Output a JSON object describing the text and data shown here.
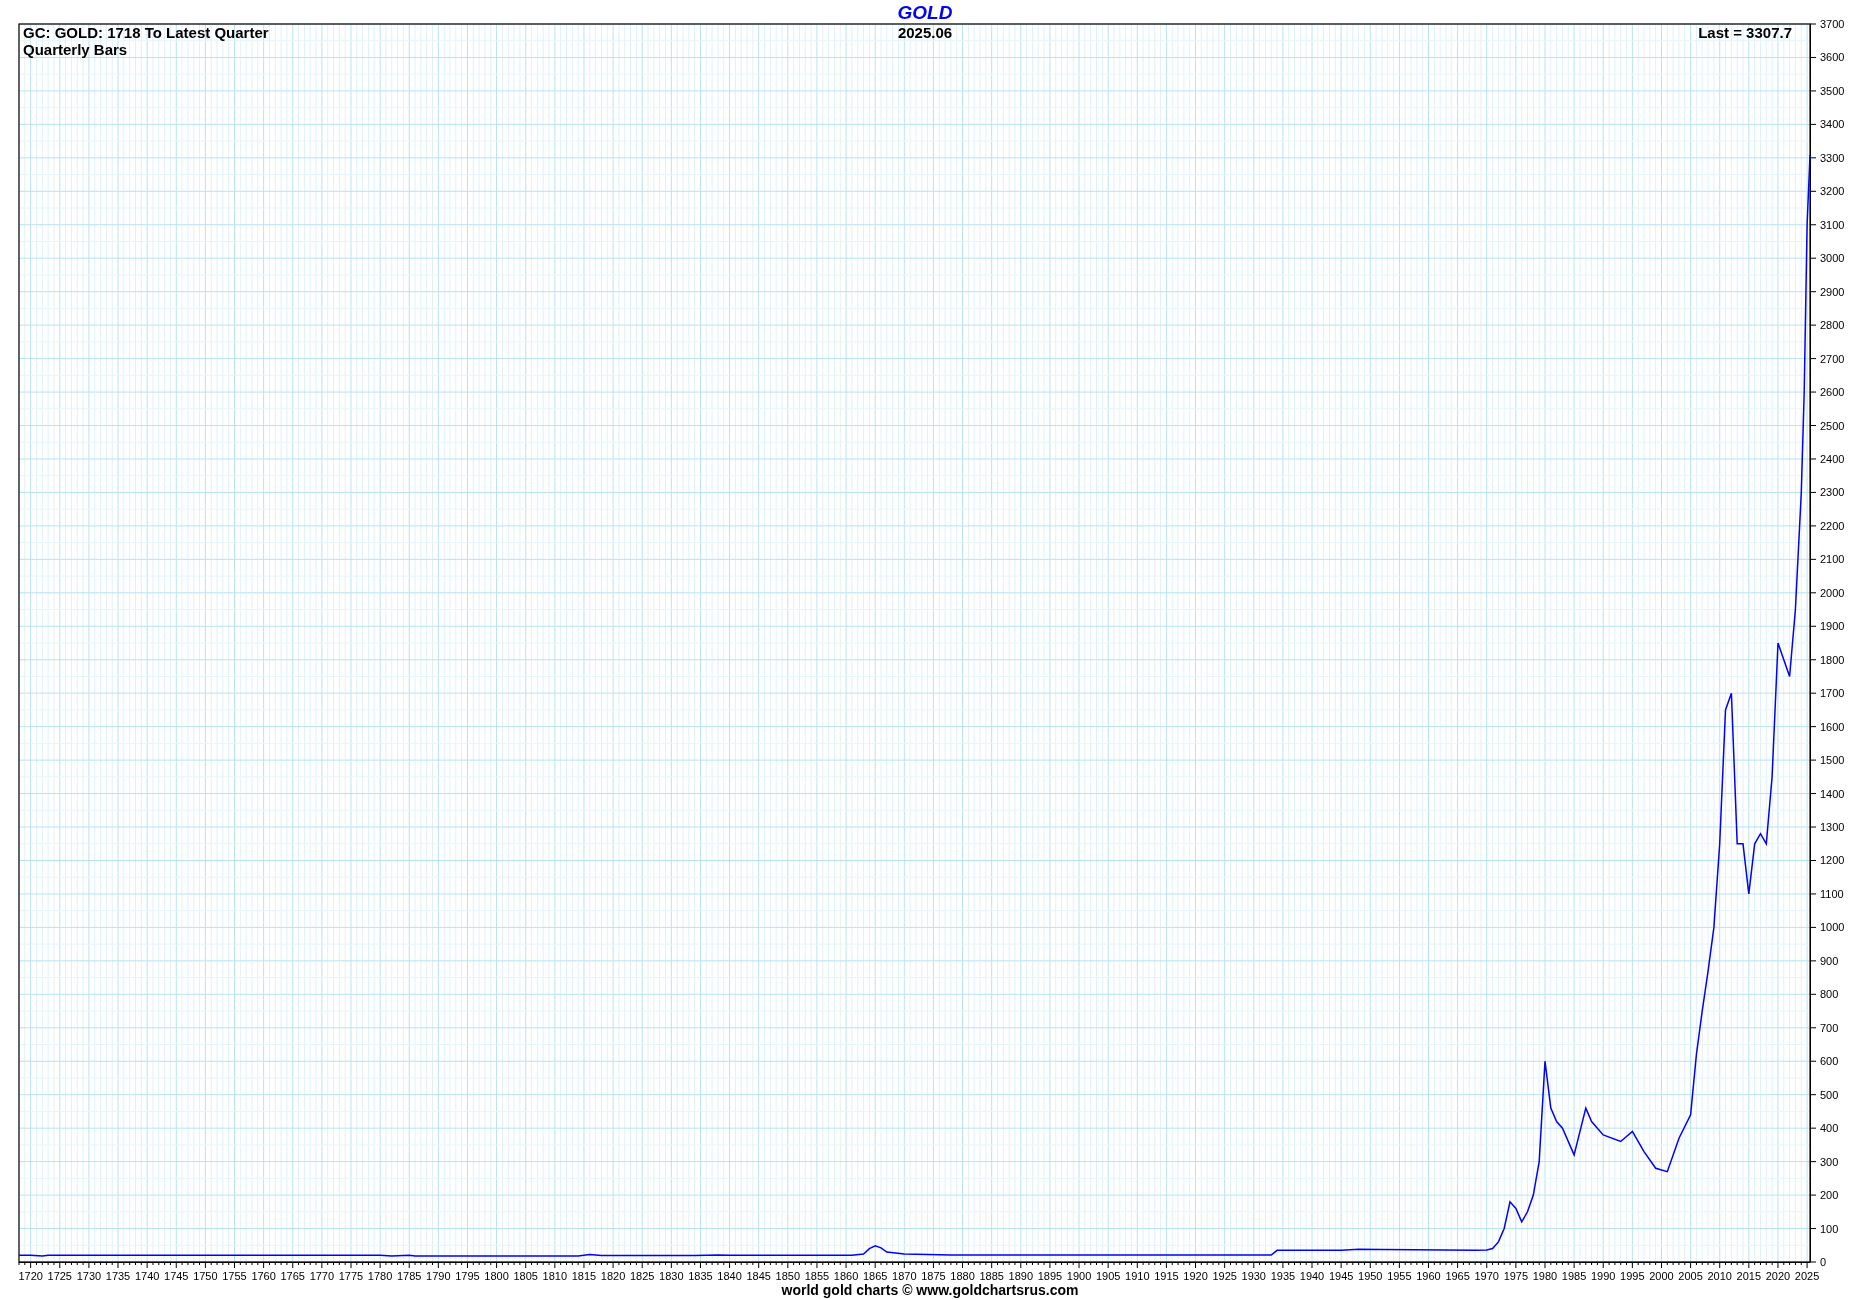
{
  "header": {
    "subtitle": "GC: GOLD: 1718 To Latest Quarter",
    "bar_type": "Quarterly Bars",
    "date": "2025.06",
    "last": "Last = 3307.7"
  },
  "chart_data": {
    "type": "line",
    "title": "GOLD",
    "grid": true,
    "xlim": [
      1718,
      2025.5
    ],
    "ylim": [
      0,
      3700
    ],
    "xticks": [
      1720,
      1725,
      1730,
      1735,
      1740,
      1745,
      1750,
      1755,
      1760,
      1765,
      1770,
      1775,
      1780,
      1785,
      1790,
      1795,
      1800,
      1805,
      1810,
      1815,
      1820,
      1825,
      1830,
      1835,
      1840,
      1845,
      1850,
      1855,
      1860,
      1865,
      1870,
      1875,
      1880,
      1885,
      1890,
      1895,
      1900,
      1905,
      1910,
      1915,
      1920,
      1925,
      1930,
      1935,
      1940,
      1945,
      1950,
      1955,
      1960,
      1965,
      1970,
      1975,
      1980,
      1985,
      1990,
      1995,
      2000,
      2005,
      2010,
      2015,
      2020,
      2025
    ],
    "yticks": [
      0,
      100,
      200,
      300,
      400,
      500,
      600,
      700,
      800,
      900,
      1000,
      1100,
      1200,
      1300,
      1400,
      1500,
      1600,
      1700,
      1800,
      1900,
      2000,
      2100,
      2200,
      2300,
      2400,
      2500,
      2600,
      2700,
      2800,
      2900,
      3000,
      3100,
      3200,
      3300,
      3400,
      3500,
      3600,
      3700
    ],
    "x": [
      1718,
      1720,
      1722,
      1723,
      1780,
      1782,
      1785,
      1786,
      1814,
      1816,
      1818,
      1834,
      1838,
      1840,
      1861,
      1863,
      1864,
      1865,
      1866,
      1867,
      1870,
      1878,
      1933,
      1934,
      1945,
      1948,
      1952,
      1968,
      1970,
      1971,
      1972,
      1973,
      1974,
      1975,
      1976,
      1977,
      1978,
      1979,
      1980,
      1981,
      1982,
      1983,
      1985,
      1987,
      1988,
      1990,
      1993,
      1995,
      1997,
      1999,
      2001,
      2003,
      2005,
      2006,
      2007,
      2008,
      2009,
      2010,
      2011,
      2012,
      2013,
      2014,
      2015,
      2016,
      2017,
      2018,
      2019,
      2020,
      2021,
      2022,
      2023,
      2024,
      2024.5,
      2025,
      2025.5
    ],
    "series": [
      {
        "color": "#0000ff",
        "values": [
          20,
          20,
          18,
          20,
          20,
          18,
          20,
          18,
          18,
          22,
          19,
          19,
          21,
          20,
          20,
          24,
          40,
          48,
          42,
          30,
          24,
          21,
          21,
          35,
          35,
          38,
          37,
          35,
          36,
          40,
          60,
          100,
          180,
          160,
          120,
          150,
          200,
          300,
          600,
          460,
          420,
          400,
          320,
          460,
          420,
          380,
          360,
          390,
          330,
          280,
          270,
          370,
          440,
          620,
          750,
          870,
          1000,
          1250,
          1650,
          1700,
          1250,
          1250,
          1100,
          1250,
          1280,
          1250,
          1450,
          1850,
          1800,
          1750,
          1950,
          2300,
          2600,
          3100,
          3308
        ]
      }
    ]
  },
  "footer": "world gold charts © www.goldchartsrus.com"
}
